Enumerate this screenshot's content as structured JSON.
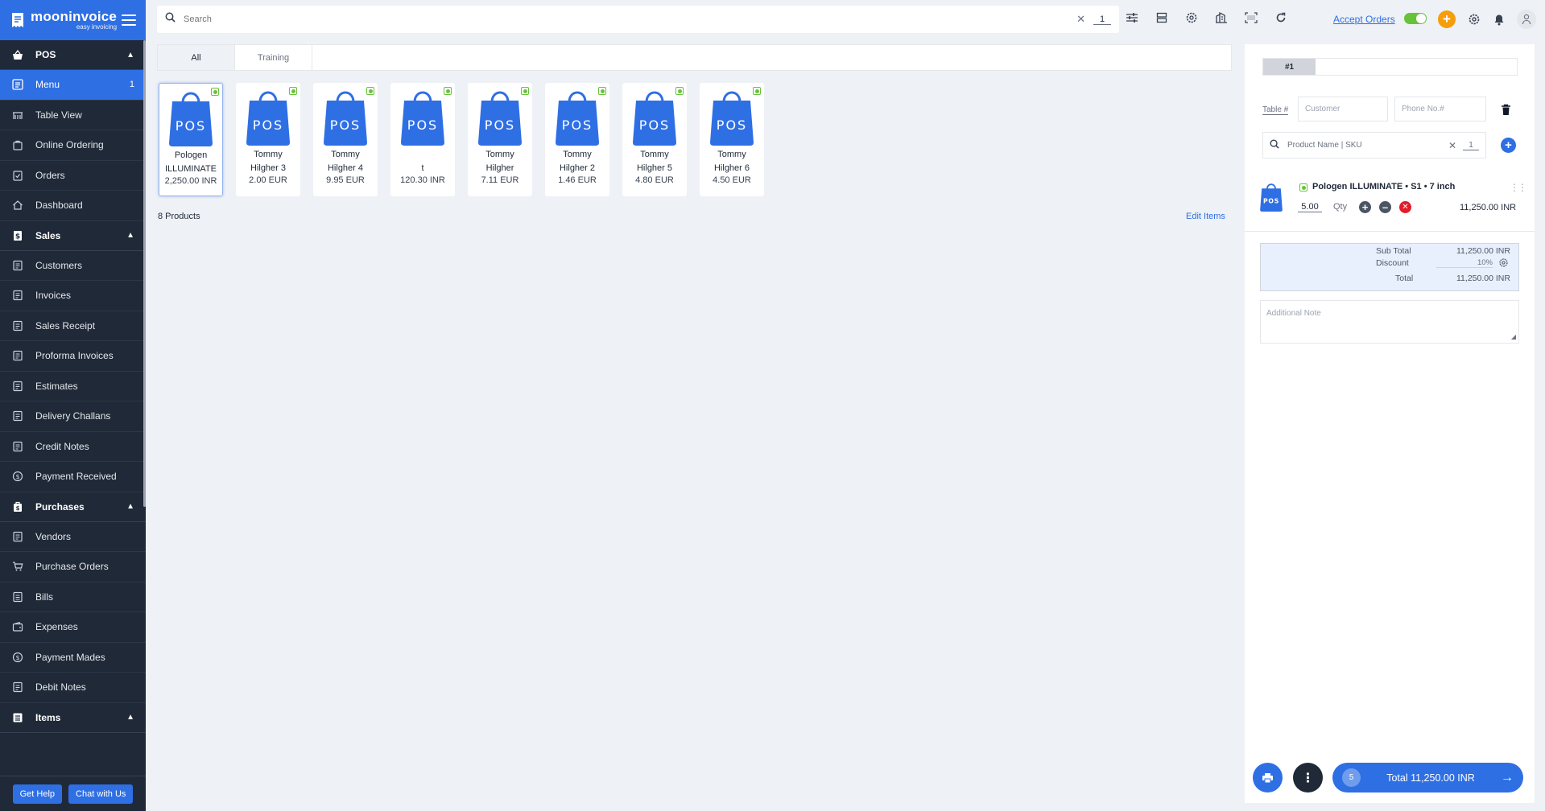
{
  "app": {
    "name": "mooninvoice",
    "tagline": "easy invoicing"
  },
  "sidebar": {
    "pos_section": "POS",
    "pos_items": [
      {
        "label": "Menu",
        "count": "1",
        "icon": "menu-icon"
      },
      {
        "label": "Table View",
        "icon": "table-view-icon"
      },
      {
        "label": "Online Ordering",
        "icon": "online-ordering-icon"
      },
      {
        "label": "Orders",
        "icon": "orders-icon"
      },
      {
        "label": "Dashboard",
        "icon": "dashboard-icon"
      }
    ],
    "sales_section": "Sales",
    "sales_items": [
      {
        "label": "Customers"
      },
      {
        "label": "Invoices"
      },
      {
        "label": "Sales Receipt"
      },
      {
        "label": "Proforma Invoices"
      },
      {
        "label": "Estimates"
      },
      {
        "label": "Delivery Challans"
      },
      {
        "label": "Credit Notes"
      },
      {
        "label": "Payment Received"
      }
    ],
    "purchases_section": "Purchases",
    "purchases_items": [
      {
        "label": "Vendors"
      },
      {
        "label": "Purchase Orders"
      },
      {
        "label": "Bills"
      },
      {
        "label": "Expenses"
      },
      {
        "label": "Payment Mades"
      },
      {
        "label": "Debit Notes"
      }
    ],
    "items_section": "Items",
    "help_label": "Get Help",
    "chat_label": "Chat with Us"
  },
  "topbar": {
    "search_placeholder": "Search",
    "search_qty": "1",
    "accept_orders": "Accept Orders"
  },
  "tabs": [
    {
      "label": "All"
    },
    {
      "label": "Training"
    }
  ],
  "products": [
    {
      "name1": "Pologen",
      "name2": "ILLUMINATE",
      "price": "2,250.00 INR"
    },
    {
      "name1": "Tommy",
      "name2": "Hilgher 3",
      "price": "2.00 EUR"
    },
    {
      "name1": "Tommy",
      "name2": "Hilgher 4",
      "price": "9.95 EUR"
    },
    {
      "name1": "",
      "name2": "t",
      "price": "120.30 INR"
    },
    {
      "name1": "Tommy",
      "name2": "Hilgher",
      "price": "7.11 EUR"
    },
    {
      "name1": "Tommy",
      "name2": "Hilgher 2",
      "price": "1.46 EUR"
    },
    {
      "name1": "Tommy",
      "name2": "Hilgher 5",
      "price": "4.80 EUR"
    },
    {
      "name1": "Tommy",
      "name2": "Hilgher 6",
      "price": "4.50 EUR"
    }
  ],
  "bag_label": "POS",
  "products_count": "8 Products",
  "edit_items": "Edit Items",
  "order": {
    "number": "#1",
    "table_label": "Table #",
    "customer_placeholder": "Customer",
    "phone_placeholder": "Phone No.#",
    "product_search_placeholder": "Product Name | SKU",
    "product_qty": "1",
    "line": {
      "title": "Pologen ILLUMINATE  •  S1  •  7 inch",
      "qty": "5.00",
      "qty_label": "Qty",
      "amount": "11,250.00 INR"
    },
    "subtotal_label": "Sub Total",
    "subtotal": "11,250.00 INR",
    "discount_label": "Discount",
    "discount": "10%",
    "total_label": "Total",
    "total": "11,250.00 INR",
    "note_placeholder": "Additional Note",
    "item_count": "5",
    "total_button": "Total 11,250.00 INR"
  },
  "colors": {
    "primary": "#2f6fe4",
    "sidebar": "#1f2937",
    "accent_orange": "#f59e0b",
    "online_green": "#67c23a"
  }
}
